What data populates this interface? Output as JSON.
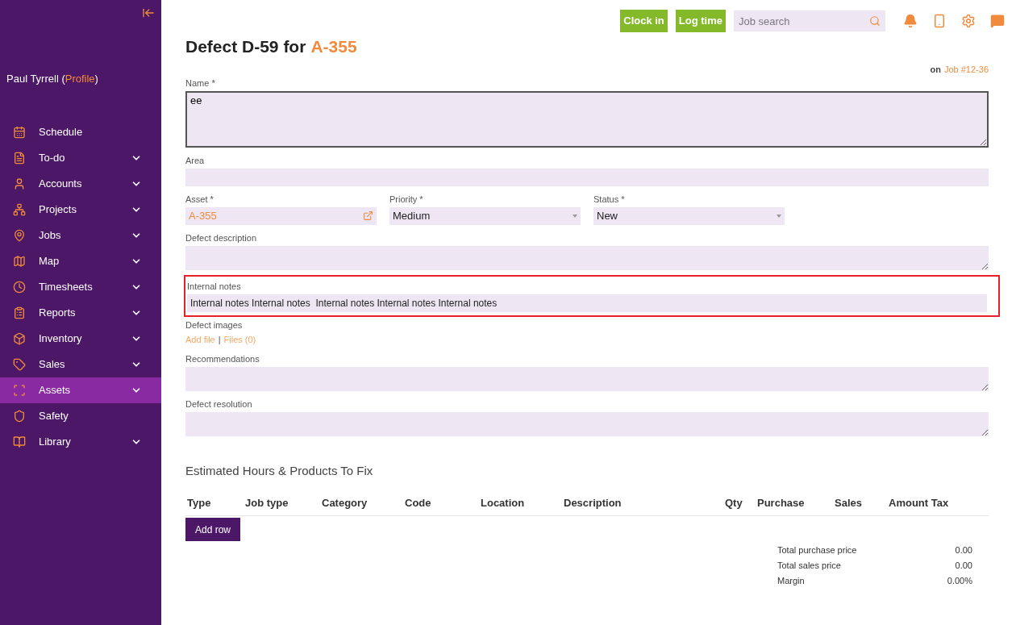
{
  "sidebar": {
    "user": {
      "name": "Paul Tyrrell (",
      "profile_link": "Profile",
      "after": ")"
    },
    "items": [
      {
        "label": "Schedule",
        "expandable": false,
        "selected": false
      },
      {
        "label": "To-do",
        "expandable": true,
        "selected": false
      },
      {
        "label": "Accounts",
        "expandable": true,
        "selected": false
      },
      {
        "label": "Projects",
        "expandable": true,
        "selected": false
      },
      {
        "label": "Jobs",
        "expandable": true,
        "selected": false
      },
      {
        "label": "Map",
        "expandable": true,
        "selected": false
      },
      {
        "label": "Timesheets",
        "expandable": true,
        "selected": false
      },
      {
        "label": "Reports",
        "expandable": true,
        "selected": false
      },
      {
        "label": "Inventory",
        "expandable": true,
        "selected": false
      },
      {
        "label": "Sales",
        "expandable": true,
        "selected": false
      },
      {
        "label": "Assets",
        "expandable": true,
        "selected": true
      },
      {
        "label": "Safety",
        "expandable": false,
        "selected": false
      },
      {
        "label": "Library",
        "expandable": true,
        "selected": false
      }
    ]
  },
  "topbar": {
    "buttons": [
      "Clock in",
      "Log time"
    ],
    "search": {
      "placeholder": "Job search"
    }
  },
  "page": {
    "title": "Defect D-59 for",
    "title_link": "A-355",
    "job_ref": {
      "prefix": "on",
      "link": "Job #12-36"
    }
  },
  "form": {
    "name": {
      "label": "Name *",
      "value": "ee"
    },
    "area": {
      "label": "Area"
    },
    "asset": {
      "label": "Asset *",
      "value": "A-355"
    },
    "priority": {
      "label": "Priority *",
      "value": "Medium"
    },
    "status": {
      "label": "Status *",
      "value": "New"
    },
    "defect_description": {
      "label": "Defect description"
    },
    "internal_notes": {
      "label": "Internal notes",
      "value": "Internal notes Internal notes  Internal notes Internal notes Internal notes",
      "highlighted": true
    },
    "defect_images": {
      "label": "Defect images",
      "add_link": "Add file",
      "separator": "|",
      "files_link": "Files (0)"
    },
    "recommendations": {
      "label": "Recommendations"
    },
    "defect_resolution": {
      "label": "Defect resolution"
    }
  },
  "estimate": {
    "title": "Estimated Hours & Products To Fix",
    "columns": [
      "Type",
      "Job type",
      "Category",
      "Code",
      "Location",
      "Description",
      "Qty",
      "Purchase",
      "Sales",
      "Amount Tax"
    ],
    "add_button": "Add row",
    "totals": [
      {
        "label": "Total purchase price",
        "value": "0.00"
      },
      {
        "label": "Total sales price",
        "value": "0.00"
      },
      {
        "label": "Margin",
        "value": "0.00%"
      }
    ]
  }
}
